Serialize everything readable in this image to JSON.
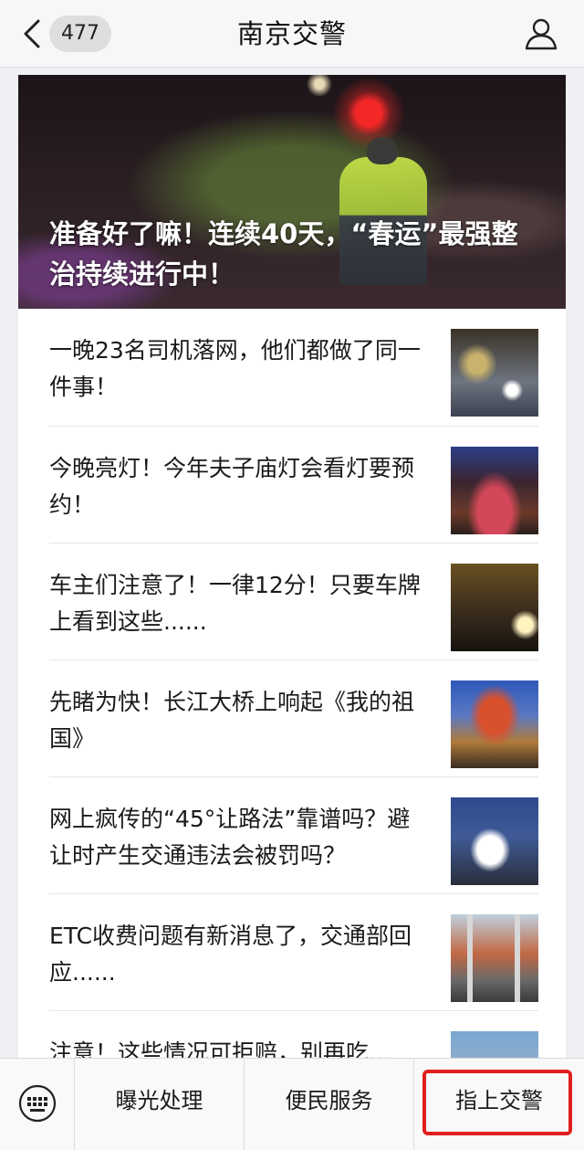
{
  "header": {
    "back_badge": "477",
    "title": "南京交警"
  },
  "hero": {
    "title": "准备好了嘛！连续40天，“春运”最强整治持续进行中！"
  },
  "articles": [
    {
      "title": "一晚23名司机落网，他们都做了同一件事！"
    },
    {
      "title": "今晚亮灯！今年夫子庙灯会看灯要预约！"
    },
    {
      "title": "车主们注意了！一律12分！只要车牌上看到这些......"
    },
    {
      "title": "先睹为快！长江大桥上响起《我的祖国》"
    },
    {
      "title": "网上疯传的“45°让路法”靠谱吗？避让时产生交通违法会被罚吗？"
    },
    {
      "title": "ETC收费问题有新消息了，交通部回应......"
    },
    {
      "title": "注意！这些情况可拒赔，别再吃..."
    }
  ],
  "bottom_menu": {
    "items": [
      "曝光处理",
      "便民服务",
      "指上交警"
    ],
    "highlight_color": "#e0201d"
  }
}
